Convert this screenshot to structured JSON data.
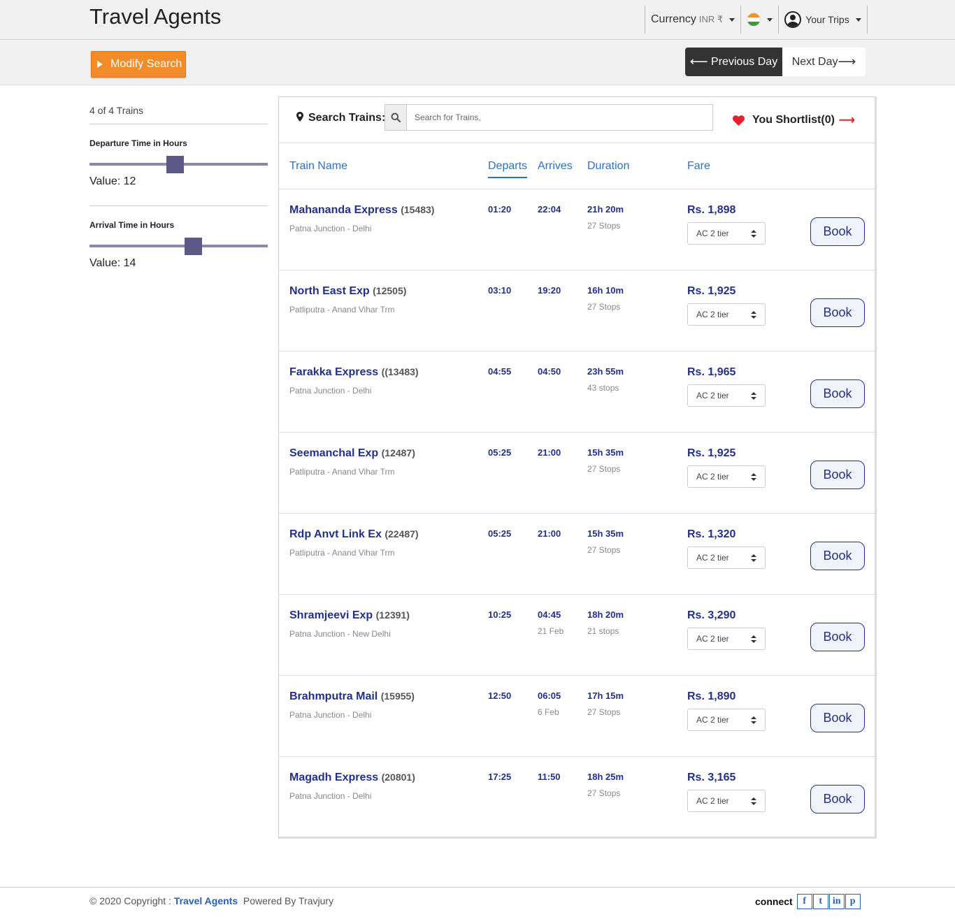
{
  "header": {
    "brand": "Travel Agents",
    "currency_label": "Currency",
    "currency_code": "INR ₹",
    "country_flag": "india-flag",
    "trips_label": "Your Trips"
  },
  "subbar": {
    "modify_search": "Modify Search",
    "prev_day": "Previous Day",
    "next_day": "Next Day"
  },
  "sidebar": {
    "count": "4 of 4 Trains",
    "filters": [
      {
        "title": "Departure Time in Hours",
        "value_text": "Value: 12",
        "value": 12,
        "max": 24
      },
      {
        "title": "Arrival Time in Hours",
        "value_text": "Value: 14",
        "value": 14,
        "max": 24
      }
    ]
  },
  "search": {
    "label": "Search Trains:",
    "placeholder": "Search for Trains,",
    "shortlist": "You Shortlist(0)"
  },
  "columns": {
    "train_name": "Train Name",
    "departs": "Departs",
    "arrives": "Arrives",
    "duration": "Duration",
    "fare": "Fare"
  },
  "trains": [
    {
      "name": "Mahananda Express",
      "number": "(15483)",
      "route": "Patna Junction - Delhi",
      "departs": "01:20",
      "arrives": "22:04",
      "arrive_sub": "",
      "duration": "21h 20m",
      "stops": "27 Stops",
      "fare": "Rs. 1,898",
      "class": "AC 2 tier",
      "book": "Book"
    },
    {
      "name": "North East Exp",
      "number": "(12505)",
      "route": "Patliputra - Anand Vihar Trm",
      "departs": "03:10",
      "arrives": "19:20",
      "arrive_sub": "",
      "duration": "16h 10m",
      "stops": "27 Stops",
      "fare": "Rs. 1,925",
      "class": "AC 2 tier",
      "book": "Book"
    },
    {
      "name": "Farakka Express",
      "number": "((13483)",
      "route": "Patna Junction - Delhi",
      "departs": "04:55",
      "arrives": "04:50",
      "arrive_sub": "",
      "duration": "23h 55m",
      "stops": "43 stops",
      "fare": "Rs. 1,965",
      "class": "AC 2 tier",
      "book": "Book"
    },
    {
      "name": "Seemanchal Exp",
      "number": "(12487)",
      "route": "Patliputra - Anand Vihar Trm",
      "departs": "05:25",
      "arrives": "21:00",
      "arrive_sub": "",
      "duration": "15h 35m",
      "stops": "27 Stops",
      "fare": "Rs. 1,925",
      "class": "AC 2 tier",
      "book": "Book"
    },
    {
      "name": "Rdp Anvt Link Ex",
      "number": "(22487)",
      "route": "Patliputra - Anand Vihar Trm",
      "departs": "05:25",
      "arrives": "21:00",
      "arrive_sub": "",
      "duration": "15h 35m",
      "stops": "27 Stops",
      "fare": "Rs. 1,320",
      "class": "AC 2 tier",
      "book": "Book"
    },
    {
      "name": "Shramjeevi Exp",
      "number": "(12391)",
      "route": "Patna Junction - New Delhi",
      "departs": "10:25",
      "arrives": "04:45",
      "arrive_sub": "21 Feb",
      "duration": "18h 20m",
      "stops": "21 stops",
      "fare": "Rs. 3,290",
      "class": "AC 2 tier",
      "book": "Book"
    },
    {
      "name": "Brahmputra Mail",
      "number": "(15955)",
      "route": "Patna Junction - Delhi",
      "departs": "12:50",
      "arrives": "06:05",
      "arrive_sub": "6 Feb",
      "duration": "17h 15m",
      "stops": "27 Stops",
      "fare": "Rs. 1,890",
      "class": "AC 2 tier",
      "book": "Book"
    },
    {
      "name": "Magadh Express",
      "number": "(20801)",
      "route": "Patna Junction - Delhi",
      "departs": "17:25",
      "arrives": "11:50",
      "arrive_sub": "",
      "duration": "18h 25m",
      "stops": "27 Stops",
      "fare": "Rs. 3,165",
      "class": "AC 2 tier",
      "book": "Book"
    }
  ],
  "footer": {
    "copyright": "© 2020 Copyright :",
    "brand_link": "Travel Agents",
    "powered": "Powered By Travjury",
    "connect": "connect",
    "social": [
      {
        "name": "facebook-icon",
        "glyph": "f"
      },
      {
        "name": "twitter-icon",
        "glyph": "t"
      },
      {
        "name": "linkedin-icon",
        "glyph": "in"
      },
      {
        "name": "pinterest-icon",
        "glyph": "p"
      }
    ]
  },
  "colors": {
    "accent_orange": "#f28c28",
    "train_blue": "#22308a",
    "link_blue": "#2a72c8",
    "slider": "#5c5987",
    "shortlist_red": "#e8202a"
  }
}
